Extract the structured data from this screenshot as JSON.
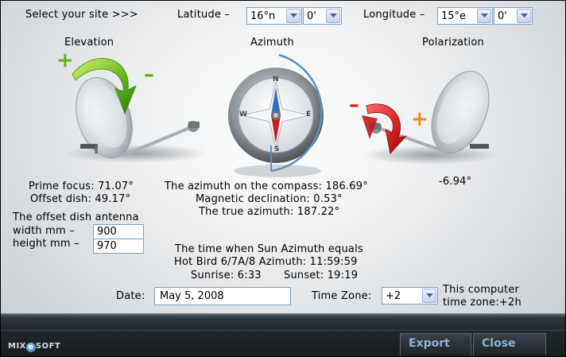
{
  "header": {
    "select_site": "Select your site >>>",
    "latitude_label": "Latitude  –",
    "latitude_deg": "16°n",
    "latitude_min": "0'",
    "longitude_label": "Longitude  –",
    "longitude_deg": "15°e",
    "longitude_min": "0'"
  },
  "sections": {
    "elevation": "Elevation",
    "azimuth": "Azimuth",
    "polarization": "Polarization"
  },
  "icons": {
    "elevation_plus": "+",
    "elevation_minus": "–",
    "polarization_minus": "–",
    "polarization_plus": "+",
    "compass_n": "N",
    "compass_e": "E",
    "compass_s": "S",
    "compass_w": "W"
  },
  "results": {
    "prime_focus": "Prime focus: 71.07°",
    "offset_dish": "Offset dish: 49.17°",
    "azimuth_compass": "The azimuth on the compass: 186.69°",
    "magnetic_declination": "Magnetic declination: 0.53°",
    "true_azimuth": "The true azimuth: 187.22°",
    "polarization_value": "-6.94°"
  },
  "antenna": {
    "title": "The offset dish antenna",
    "width_label": "width  mm  –",
    "width_value": "900",
    "height_label": "height mm  –",
    "height_value": "970"
  },
  "sun": {
    "line1": "The time when Sun Azimuth equals",
    "line2": "Hot Bird 6/7A/8 Azimuth: 11:59:59",
    "sunrise": "Sunrise: 6:33",
    "sunset": "Sunset: 19:19"
  },
  "date": {
    "label": "Date:",
    "value": "May 5, 2008"
  },
  "timezone": {
    "label": "Time Zone:",
    "value": "+2",
    "note_line1": "This computer",
    "note_line2": "time zone:+2h"
  },
  "footer": {
    "logo_mix": "MIX",
    "logo_e": "e",
    "logo_soft": "SOFT",
    "export_label": "Export",
    "close_label": "Close"
  },
  "colors": {
    "accent_green": "#5cb21c",
    "accent_red": "#d42020",
    "accent_orange": "#f28a14",
    "button_text": "#8fb2d2"
  }
}
